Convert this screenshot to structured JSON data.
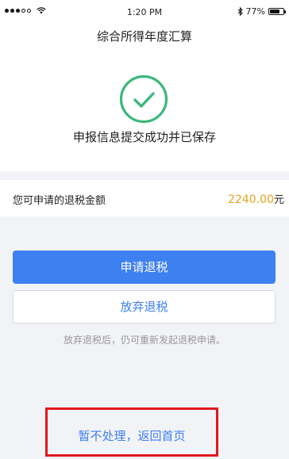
{
  "status_bar": {
    "time": "1:20 PM",
    "battery_text": "77%",
    "battery_level": 0.77,
    "signal_bars_filled": 3,
    "signal_bars_total": 5,
    "icons": [
      "wifi-icon",
      "bluetooth-icon",
      "battery-icon"
    ]
  },
  "header": {
    "title": "综合所得年度汇算"
  },
  "result": {
    "icon": "check-circle-icon",
    "message": "申报信息提交成功并已保存"
  },
  "refund": {
    "label": "您可申请的退税金额",
    "amount": "2240.00",
    "unit": "元"
  },
  "actions": {
    "apply_label": "申请退税",
    "abandon_label": "放弃退税",
    "hint": "放弃退税后，仍可重新发起退税申请。",
    "return_label": "暂不处理，返回首页"
  },
  "colors": {
    "primary": "#3d80f0",
    "success": "#3bb87d",
    "amount": "#e8a21a",
    "annotation": "#e0181d"
  }
}
